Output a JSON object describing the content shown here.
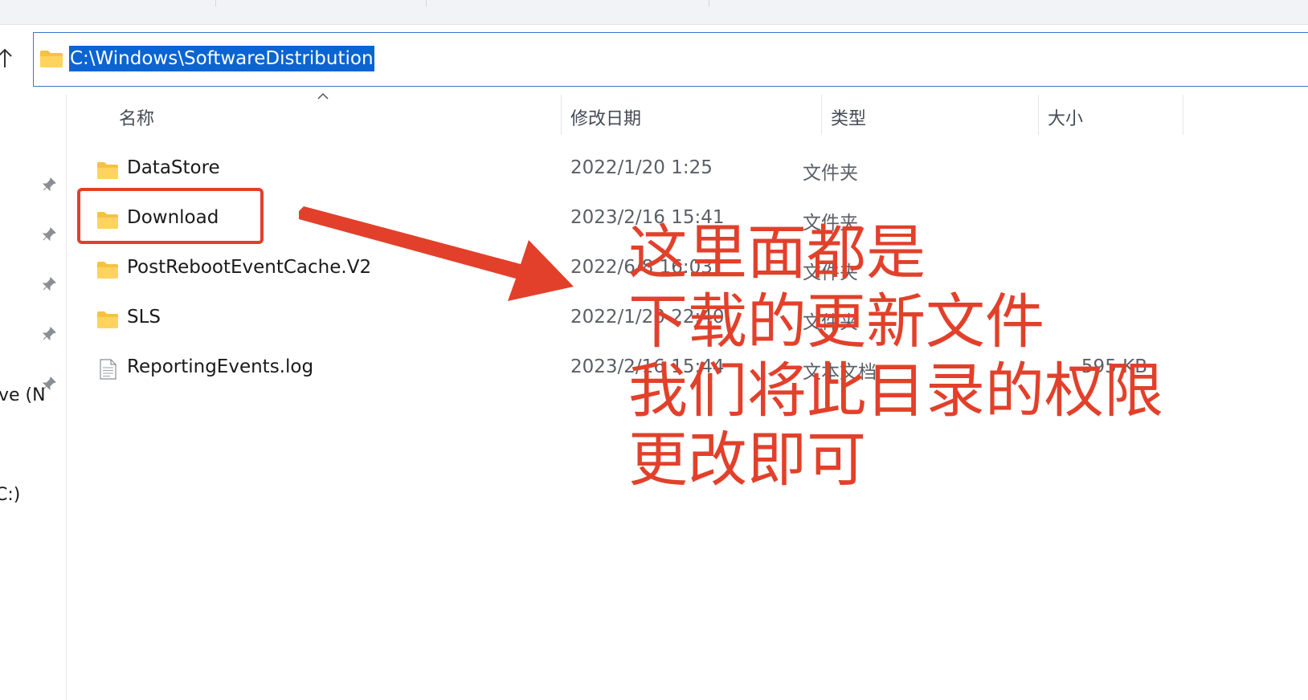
{
  "address_bar": {
    "path": "C:\\Windows\\SoftwareDistribution"
  },
  "nav_pane": {
    "fragments": [
      "ve (N",
      "C:)"
    ]
  },
  "columns": {
    "name": "名称",
    "date": "修改日期",
    "type": "类型",
    "size": "大小"
  },
  "files": [
    {
      "name": "DataStore",
      "date": "2022/1/20 1:25",
      "type": "文件夹",
      "size": "",
      "icon": "folder-icon"
    },
    {
      "name": "Download",
      "date": "2023/2/16 15:41",
      "type": "文件夹",
      "size": "",
      "icon": "folder-icon"
    },
    {
      "name": "PostRebootEventCache.V2",
      "date": "2022/6/8 16:03",
      "type": "文件夹",
      "size": "",
      "icon": "folder-icon"
    },
    {
      "name": "SLS",
      "date": "2022/1/20 22:40",
      "type": "文件夹",
      "size": "",
      "icon": "folder-icon"
    },
    {
      "name": "ReportingEvents.log",
      "date": "2023/2/16 15:44",
      "type": "文本文档",
      "size": "595 KB",
      "icon": "text-file-icon"
    }
  ],
  "annotation": {
    "lines": [
      "这里面都是",
      "下载的更新文件",
      "我们将此目录的权限",
      "更改即可"
    ]
  },
  "colors": {
    "annotation_red": "#e2402a",
    "selection_blue": "#0a64d2",
    "folder_yellow": "#f6c244"
  }
}
